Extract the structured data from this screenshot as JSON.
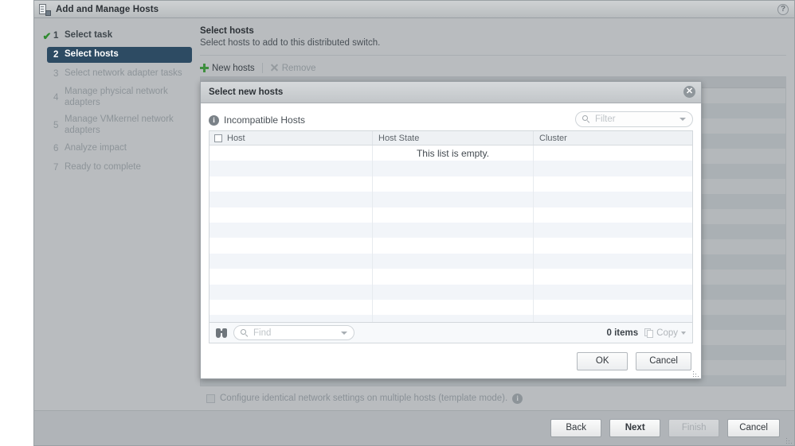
{
  "window": {
    "title": "Add and Manage Hosts",
    "app_icon": "switch-icon",
    "help_icon": "help-question-icon"
  },
  "sidebar": {
    "steps": [
      {
        "num": "1",
        "label": "Select task",
        "state": "done",
        "check": "✔"
      },
      {
        "num": "2",
        "label": "Select hosts",
        "state": "current"
      },
      {
        "num": "3",
        "label": "Select network adapter tasks",
        "state": "pending"
      },
      {
        "num": "4",
        "label": "Manage physical network adapters",
        "state": "pending"
      },
      {
        "num": "5",
        "label": "Manage VMkernel network adapters",
        "state": "pending"
      },
      {
        "num": "6",
        "label": "Analyze impact",
        "state": "pending"
      },
      {
        "num": "7",
        "label": "Ready to complete",
        "state": "pending"
      }
    ]
  },
  "content": {
    "title": "Select hosts",
    "subtitle": "Select hosts to add to this distributed switch.",
    "toolbar": {
      "new_hosts_label": "New hosts",
      "new_hosts_icon": "plus-icon",
      "remove_label": "Remove",
      "remove_icon": "remove-x-icon"
    },
    "template_checkbox": {
      "label": "Configure identical network settings on multiple hosts (template mode).",
      "checked": false,
      "info_icon": "info-icon"
    }
  },
  "wizard_footer": {
    "back": "Back",
    "next": "Next",
    "finish": "Finish",
    "cancel": "Cancel",
    "finish_disabled": true
  },
  "modal": {
    "title": "Select new hosts",
    "close_icon": "close-icon",
    "incompatible_label": "Incompatible Hosts",
    "incompatible_icon": "info-icon",
    "filter": {
      "placeholder": "Filter",
      "value": "",
      "search_icon": "search-icon",
      "dropdown_icon": "chevron-down-icon"
    },
    "table": {
      "columns": [
        "Host",
        "Host State",
        "Cluster"
      ],
      "select_all_checkbox": false,
      "rows": [],
      "empty_message": "This list is empty.",
      "row_count": 12
    },
    "footer": {
      "find_icon": "binoculars-icon",
      "find_placeholder": "Find",
      "find_value": "",
      "find_dropdown_icon": "chevron-down-icon",
      "items_count": "0 items",
      "copy_label": "Copy",
      "copy_icon": "copy-icon",
      "copy_dropdown_icon": "chevron-down-icon"
    },
    "buttons": {
      "ok": "OK",
      "cancel": "Cancel"
    }
  },
  "colors": {
    "accent": "#2d4b63",
    "check_green": "#2f8a2f",
    "plus_green": "#3f8f3f",
    "chrome": "#b9bcbf"
  }
}
